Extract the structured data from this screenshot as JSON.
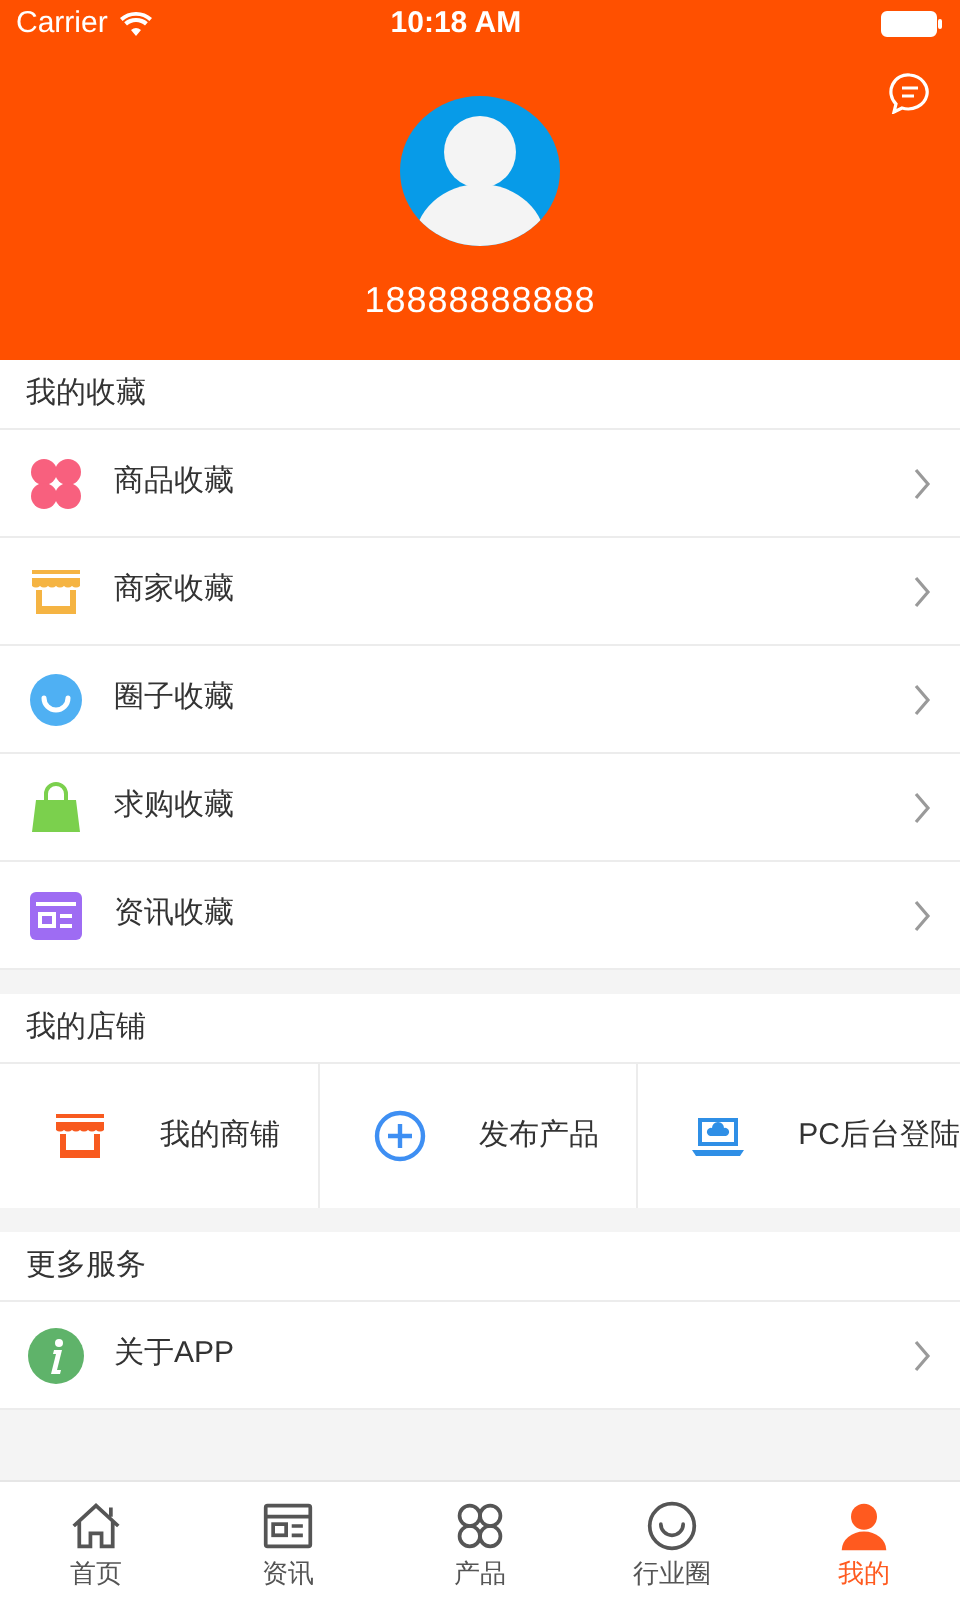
{
  "status_bar": {
    "carrier": "Carrier",
    "time": "10:18 AM"
  },
  "profile": {
    "phone": "18888888888"
  },
  "favorites": {
    "title": "我的收藏",
    "items": [
      {
        "kind": "clover",
        "label": "商品收藏"
      },
      {
        "kind": "shop",
        "label": "商家收藏"
      },
      {
        "kind": "smile",
        "label": "圈子收藏"
      },
      {
        "kind": "bag",
        "label": "求购收藏"
      },
      {
        "kind": "news",
        "label": "资讯收藏"
      }
    ]
  },
  "store": {
    "title": "我的店铺",
    "items": [
      {
        "kind": "shop",
        "label": "我的商铺"
      },
      {
        "kind": "plus",
        "label": "发布产品"
      },
      {
        "kind": "laptop",
        "label": "PC后台登陆"
      }
    ]
  },
  "more": {
    "title": "更多服务",
    "items": [
      {
        "kind": "info",
        "label": "关于APP"
      }
    ]
  },
  "tab_bar": [
    {
      "kind": "home",
      "label": "首页",
      "selected": false
    },
    {
      "kind": "news",
      "label": "资讯",
      "selected": false
    },
    {
      "kind": "clover",
      "label": "产品",
      "selected": false
    },
    {
      "kind": "smile",
      "label": "行业圈",
      "selected": false
    },
    {
      "kind": "person",
      "label": "我的",
      "selected": true
    }
  ]
}
